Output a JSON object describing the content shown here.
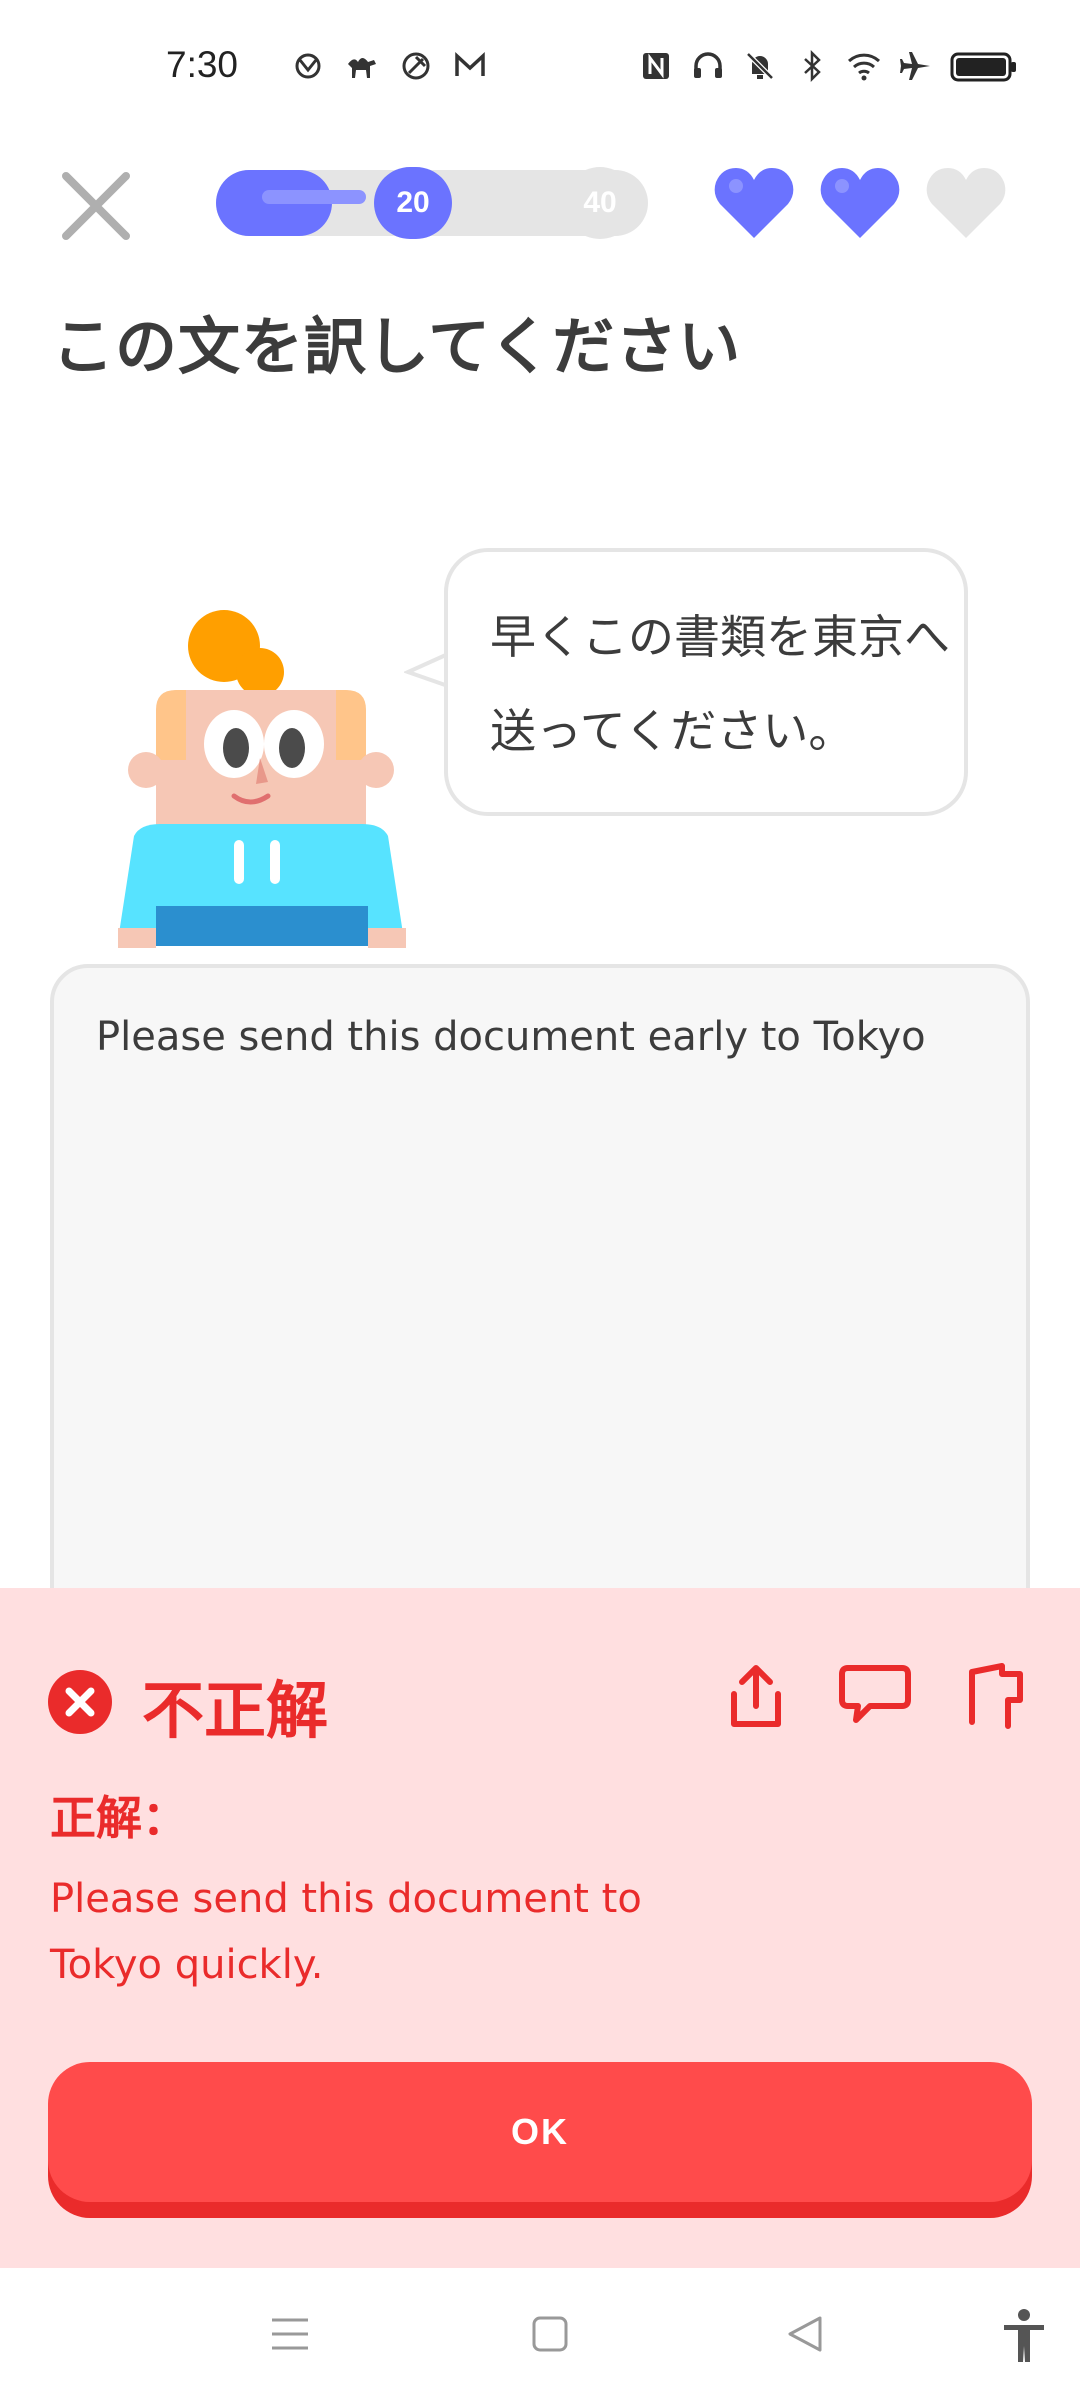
{
  "status_bar": {
    "time": "7:30",
    "left_icons": [
      "app-icon",
      "camel-icon",
      "location-icon",
      "gmail-icon"
    ],
    "right_icons": [
      "nfc-icon",
      "headphones-icon",
      "bell-muted-icon",
      "bluetooth-icon",
      "wifi-icon",
      "airplane-icon",
      "battery-icon"
    ]
  },
  "lesson": {
    "progress_start": "20",
    "progress_end": "40",
    "progress_fraction": 0.5,
    "hearts_full": 2,
    "hearts_total": 3,
    "heart_color": "#6b73ff"
  },
  "page_title": "この文を訳してください",
  "prompt_sentence": "早くこの書類を東京へ送ってください。",
  "user_answer": "Please send this document early to Tokyo",
  "feedback": {
    "status": "不正解",
    "correct_label": "正解：",
    "correct_answer": "Please send this document to Tokyo quickly.",
    "actions": [
      "share-icon",
      "comment-icon",
      "flag-icon"
    ],
    "color": "#ea2b2b",
    "background": "#ffdfe0"
  },
  "ok_button": "OK",
  "nav_bar": [
    "menu-icon",
    "home-icon",
    "back-icon",
    "accessibility-icon"
  ]
}
